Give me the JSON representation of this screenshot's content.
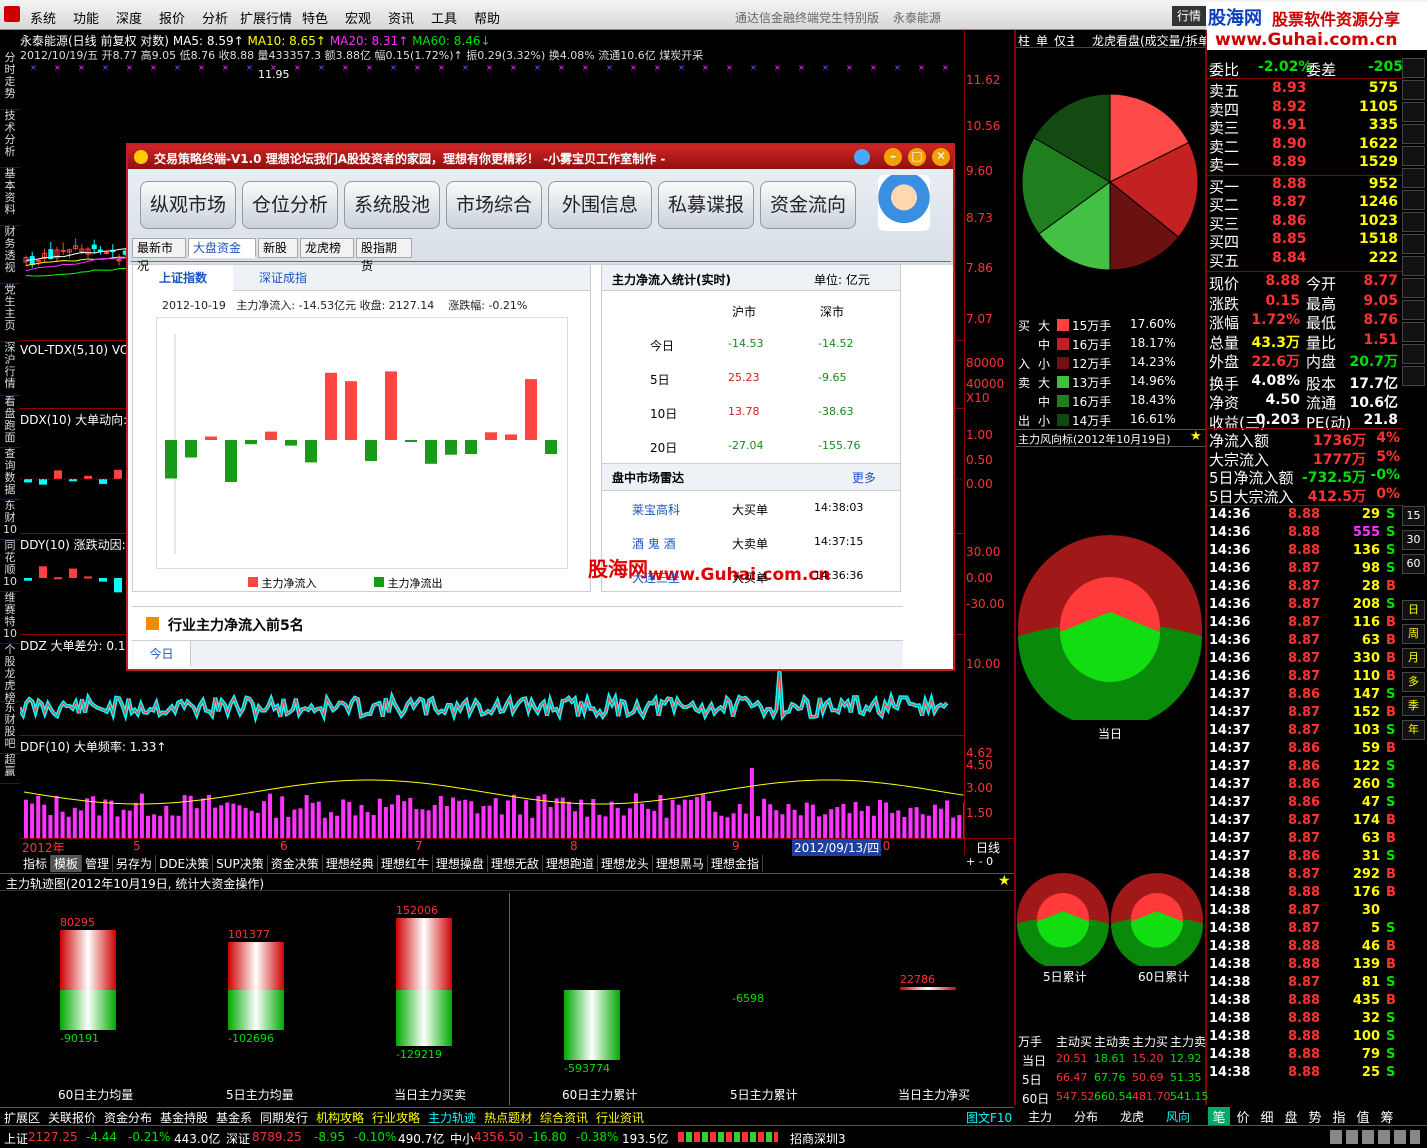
{
  "menu": {
    "items": [
      "系统",
      "功能",
      "深度",
      "报价",
      "分析",
      "扩展行情",
      "特色",
      "宏观",
      "资讯",
      "工具",
      "帮助"
    ],
    "title": "通达信金融终端党生特别版",
    "stock": "永泰能源",
    "quote_btn": "行情"
  },
  "watermark": {
    "top": "股海网",
    "top2": "股票软件资源分享",
    "url": "www.Guhai.com.cn",
    "mid": "股海网",
    "mid_url": "www.Guhai.com.cn"
  },
  "left_tabs": [
    "分时走势",
    "技术分析",
    "基本资料",
    "财务透视",
    "党生主页",
    "深沪行情",
    "看盘跑面",
    "查询数据",
    "东财10",
    "同花顺10",
    "维赛特10",
    "个股龙虎榜",
    "东财股吧",
    "超赢"
  ],
  "kline": {
    "header1": "永泰能源(日线 前复权 对数)",
    "ma5": "MA5: 8.59↑",
    "ma10": "MA10: 8.65↑",
    "ma20": "MA20: 8.31↑",
    "ma60": "MA60: 8.46↓",
    "header2": "2012/10/19/五 开8.77 高9.05 低8.76 收8.88 量433357.3 额3.88亿 幅0.15(1.72%)↑ 振0.29(3.32%) 换4.08% 流通10.6亿 煤炭开采",
    "high_mark": "11.95",
    "yaxis": [
      "11.62",
      "10.56",
      "9.60",
      "8.73",
      "7.86",
      "7.07"
    ]
  },
  "vol": {
    "header": "VOL-TDX(5,10) VO",
    "yaxis": [
      "80000",
      "40000",
      "X10"
    ]
  },
  "ddx": {
    "header": "DDX(10) 大单动向:",
    "yaxis": [
      "1.00",
      "0.50",
      "0.00"
    ]
  },
  "ddy": {
    "header": "DDY(10) 涨跌动因:",
    "yaxis": [
      "30.00",
      "0.00",
      "-30.00"
    ]
  },
  "ddz": {
    "header": "DDZ 大单差分: 0.12",
    "yaxis": [
      "10.00"
    ]
  },
  "ddf": {
    "header": "DDF(10) 大单频率: 1.33↑",
    "yaxis": [
      "4.62",
      "4.50",
      "3.00",
      "1.50"
    ]
  },
  "xaxis": {
    "labels": [
      "2012年",
      "5",
      "6",
      "7",
      "8",
      "9",
      "10"
    ],
    "cursor": "2012/09/13/四",
    "period": "日线"
  },
  "bottom_tabs": [
    "指标",
    "模板",
    "管理",
    "另存为",
    "DDE决策",
    "SUP决策",
    "资金决策",
    "理想经典",
    "理想红牛",
    "理想操盘",
    "理想无敌",
    "理想跑道",
    "理想龙头",
    "理想黑马",
    "理想金指"
  ],
  "dialog": {
    "title": "交易策略终端-V1.0  理想论坛我们A股投资者的家园，理想有你更精彩！ -小雾宝贝工作室制作 -",
    "big_buttons": [
      "纵观市场",
      "仓位分析",
      "系统股池",
      "市场综合",
      "外围信息",
      "私募谍报",
      "资金流向"
    ],
    "sub_tabs": [
      "最新市况",
      "大盘资金",
      "新股",
      "龙虎榜",
      "股指期货"
    ],
    "index_tabs": [
      "上证指数",
      "深证成指"
    ],
    "info": "2012-10-19   主力净流入: -14.53亿元 收盘: 2127.14    涨跌幅: -0.21%",
    "chart_legend": [
      "主力净流入",
      "主力净流出"
    ],
    "stats_title": "主力净流入统计(实时)",
    "stats_unit": "单位: 亿元",
    "stats_cols": [
      "沪市",
      "深市"
    ],
    "stats_rows": [
      {
        "label": "今日",
        "sh": "-14.53",
        "sz": "-14.52"
      },
      {
        "label": "5日",
        "sh": "25.23",
        "sz": "-9.65"
      },
      {
        "label": "10日",
        "sh": "13.78",
        "sz": "-38.63"
      },
      {
        "label": "20日",
        "sh": "-27.04",
        "sz": "-155.76"
      }
    ],
    "radar_title": "盘中市场雷达",
    "radar_more": "更多",
    "radar_rows": [
      {
        "name": "莱宝高科",
        "type": "大买单",
        "time": "14:38:03"
      },
      {
        "name": "酒 鬼 酒",
        "type": "大卖单",
        "time": "14:37:15"
      },
      {
        "name": "大连三垒",
        "type": "大买单",
        "time": "14:36:36"
      }
    ],
    "industry_title": "行业主力净流入前5名",
    "industry_tab": "今日"
  },
  "chart_data": [
    {
      "type": "bar",
      "values": [
        -5.5,
        -2.5,
        0.5,
        -6,
        -0.6,
        1.2,
        -0.8,
        -3.2,
        9.6,
        8.4,
        -3,
        9.8,
        -0.1,
        -3.4,
        -2.1,
        -2,
        1.1,
        0.8,
        8.7,
        -2
      ]
    }
  ],
  "right_top_tabs": [
    "柱",
    "单",
    "仅主动",
    "龙虎看盘(成交量/按",
    "拆单"
  ],
  "pie_legend": {
    "rows": [
      {
        "side": "买",
        "lvl": "大",
        "amt": "15万手",
        "pct": "17.60%",
        "color": "#ff4040"
      },
      {
        "side": "",
        "lvl": "中",
        "amt": "16万手",
        "pct": "18.17%",
        "color": "#c02020"
      },
      {
        "side": "入",
        "lvl": "小",
        "amt": "12万手",
        "pct": "14.23%",
        "color": "#701010"
      },
      {
        "side": "卖",
        "lvl": "大",
        "amt": "13万手",
        "pct": "14.96%",
        "color": "#40c040"
      },
      {
        "side": "",
        "lvl": "中",
        "amt": "16万手",
        "pct": "18.43%",
        "color": "#208020"
      },
      {
        "side": "出",
        "lvl": "小",
        "amt": "14万手",
        "pct": "16.61%",
        "color": "#104810"
      }
    ]
  },
  "windvane": {
    "title": "主力风向标(2012年10月19日)",
    "today": "当日",
    "d5": "5日累计",
    "d60": "60日累计"
  },
  "flow_table": {
    "headers": [
      "万手",
      "主动买",
      "主动卖",
      "主力买",
      "主力卖"
    ],
    "rows": [
      {
        "label": "当日",
        "v": [
          "20.51",
          "18.61",
          "15.20",
          "12.92"
        ]
      },
      {
        "label": "5日",
        "v": [
          "66.47",
          "67.76",
          "50.69",
          "51.35"
        ]
      },
      {
        "label": "60日",
        "v": [
          "547.52",
          "660.54",
          "481.70",
          "541.15"
        ]
      }
    ]
  },
  "right_bottom_tabs": [
    "主力",
    "分布",
    "龙虎",
    "风向"
  ],
  "orderbook": {
    "webi_label": "委比",
    "webi": "-2.02%",
    "weicha_label": "委差",
    "weicha": "-205",
    "asks": [
      {
        "l": "卖五",
        "p": "8.93",
        "v": "575"
      },
      {
        "l": "卖四",
        "p": "8.92",
        "v": "1105"
      },
      {
        "l": "卖三",
        "p": "8.91",
        "v": "335"
      },
      {
        "l": "卖二",
        "p": "8.90",
        "v": "1622"
      },
      {
        "l": "卖一",
        "p": "8.89",
        "v": "1529"
      }
    ],
    "bids": [
      {
        "l": "买一",
        "p": "8.88",
        "v": "952"
      },
      {
        "l": "买二",
        "p": "8.87",
        "v": "1246"
      },
      {
        "l": "买三",
        "p": "8.86",
        "v": "1023"
      },
      {
        "l": "买四",
        "p": "8.85",
        "v": "1518"
      },
      {
        "l": "买五",
        "p": "8.84",
        "v": "222"
      }
    ]
  },
  "stats": [
    [
      "现价",
      "8.88",
      "今开",
      "8.77"
    ],
    [
      "涨跌",
      "0.15",
      "最高",
      "9.05"
    ],
    [
      "涨幅",
      "1.72%",
      "最低",
      "8.76"
    ],
    [
      "总量",
      "43.3万",
      "量比",
      "1.51"
    ],
    [
      "外盘",
      "22.6万",
      "内盘",
      "20.7万"
    ],
    [
      "换手",
      "4.08%",
      "股本",
      "17.7亿"
    ],
    [
      "净资",
      "4.50",
      "流通",
      "10.6亿"
    ],
    [
      "收益(三)",
      "0.203",
      "PE(动)",
      "21.8"
    ]
  ],
  "flows": [
    [
      "净流入额",
      "1736万",
      "4%"
    ],
    [
      "大宗流入",
      "1777万",
      "5%"
    ],
    [
      "5日净流入额",
      "-732.5万",
      "-0%"
    ],
    [
      "5日大宗流入",
      "412.5万",
      "0%"
    ]
  ],
  "ticks": [
    [
      "14:36",
      "8.88",
      "29",
      "S"
    ],
    [
      "14:36",
      "8.88",
      "555",
      "S"
    ],
    [
      "14:36",
      "8.88",
      "136",
      "S"
    ],
    [
      "14:36",
      "8.87",
      "98",
      "S"
    ],
    [
      "14:36",
      "8.87",
      "28",
      "B"
    ],
    [
      "14:36",
      "8.87",
      "208",
      "S"
    ],
    [
      "14:36",
      "8.87",
      "116",
      "B"
    ],
    [
      "14:36",
      "8.87",
      "63",
      "B"
    ],
    [
      "14:36",
      "8.87",
      "330",
      "B"
    ],
    [
      "14:36",
      "8.87",
      "110",
      "B"
    ],
    [
      "14:37",
      "8.86",
      "147",
      "S"
    ],
    [
      "14:37",
      "8.87",
      "152",
      "B"
    ],
    [
      "14:37",
      "8.87",
      "103",
      "S"
    ],
    [
      "14:37",
      "8.86",
      "59",
      "B"
    ],
    [
      "14:37",
      "8.86",
      "122",
      "S"
    ],
    [
      "14:37",
      "8.86",
      "260",
      "S"
    ],
    [
      "14:37",
      "8.86",
      "47",
      "S"
    ],
    [
      "14:37",
      "8.87",
      "174",
      "B"
    ],
    [
      "14:37",
      "8.87",
      "63",
      "B"
    ],
    [
      "14:37",
      "8.86",
      "31",
      "S"
    ],
    [
      "14:38",
      "8.87",
      "292",
      "B"
    ],
    [
      "14:38",
      "8.88",
      "176",
      "B"
    ],
    [
      "14:38",
      "8.87",
      "30",
      ""
    ],
    [
      "14:38",
      "8.87",
      "5",
      "S"
    ],
    [
      "14:38",
      "8.88",
      "46",
      "B"
    ],
    [
      "14:38",
      "8.88",
      "139",
      "B"
    ],
    [
      "14:38",
      "8.87",
      "81",
      "S"
    ],
    [
      "14:38",
      "8.88",
      "435",
      "B"
    ],
    [
      "14:38",
      "8.88",
      "32",
      "S"
    ],
    [
      "14:38",
      "8.88",
      "100",
      "S"
    ],
    [
      "14:38",
      "8.88",
      "79",
      "S"
    ],
    [
      "14:38",
      "8.88",
      "25",
      "S"
    ]
  ],
  "right_nav": [
    "日",
    "周",
    "月",
    "多",
    "季",
    "年"
  ],
  "right_nav_nums": [
    "15",
    "30",
    "60"
  ],
  "bottom_tabs2": [
    "笔",
    "价",
    "细",
    "盘",
    "势",
    "指",
    "值",
    "筹"
  ],
  "trajectory": {
    "title": "主力轨迹图(2012年10月19日, 统计大资金操作)",
    "bars": [
      {
        "label": "60日主力均量",
        "top": "80295",
        "bottom": "-90191"
      },
      {
        "label": "5日主力均量",
        "top": "101377",
        "bottom": "-102696"
      },
      {
        "label": "当日主力买卖",
        "top": "152006",
        "bottom": "-129219"
      },
      {
        "label": "60日主力累计",
        "top": "",
        "bottom": "-593774"
      },
      {
        "label": "5日主力累计",
        "top": "",
        "bottom": "-6598"
      },
      {
        "label": "当日主力净买",
        "top": "22786",
        "bottom": ""
      }
    ]
  },
  "bottom_func_tabs": [
    "扩展区",
    "关联报价",
    "资金分布",
    "基金持股",
    "基金系",
    "同期发行",
    "机构攻略",
    "行业攻略",
    "主力轨迹",
    "热点题材",
    "综合资讯",
    "行业资讯"
  ],
  "bottom_func_right": "图文F10",
  "statusbar": {
    "sh_label": "上证",
    "sh": "2127.25",
    "sh_chg": "-4.44",
    "sh_pct": "-0.21%",
    "sh_amt": "443.0亿",
    "sz_label": "深证",
    "sz": "8789.25",
    "sz_chg": "-8.95",
    "sz_pct": "-0.10%",
    "sz_amt": "490.7亿",
    "zx_label": "中小",
    "zx": "4356.50",
    "zx_chg": "-16.80",
    "zx_pct": "-0.38%",
    "zx_amt": "193.5亿",
    "broker": "招商深圳3"
  }
}
